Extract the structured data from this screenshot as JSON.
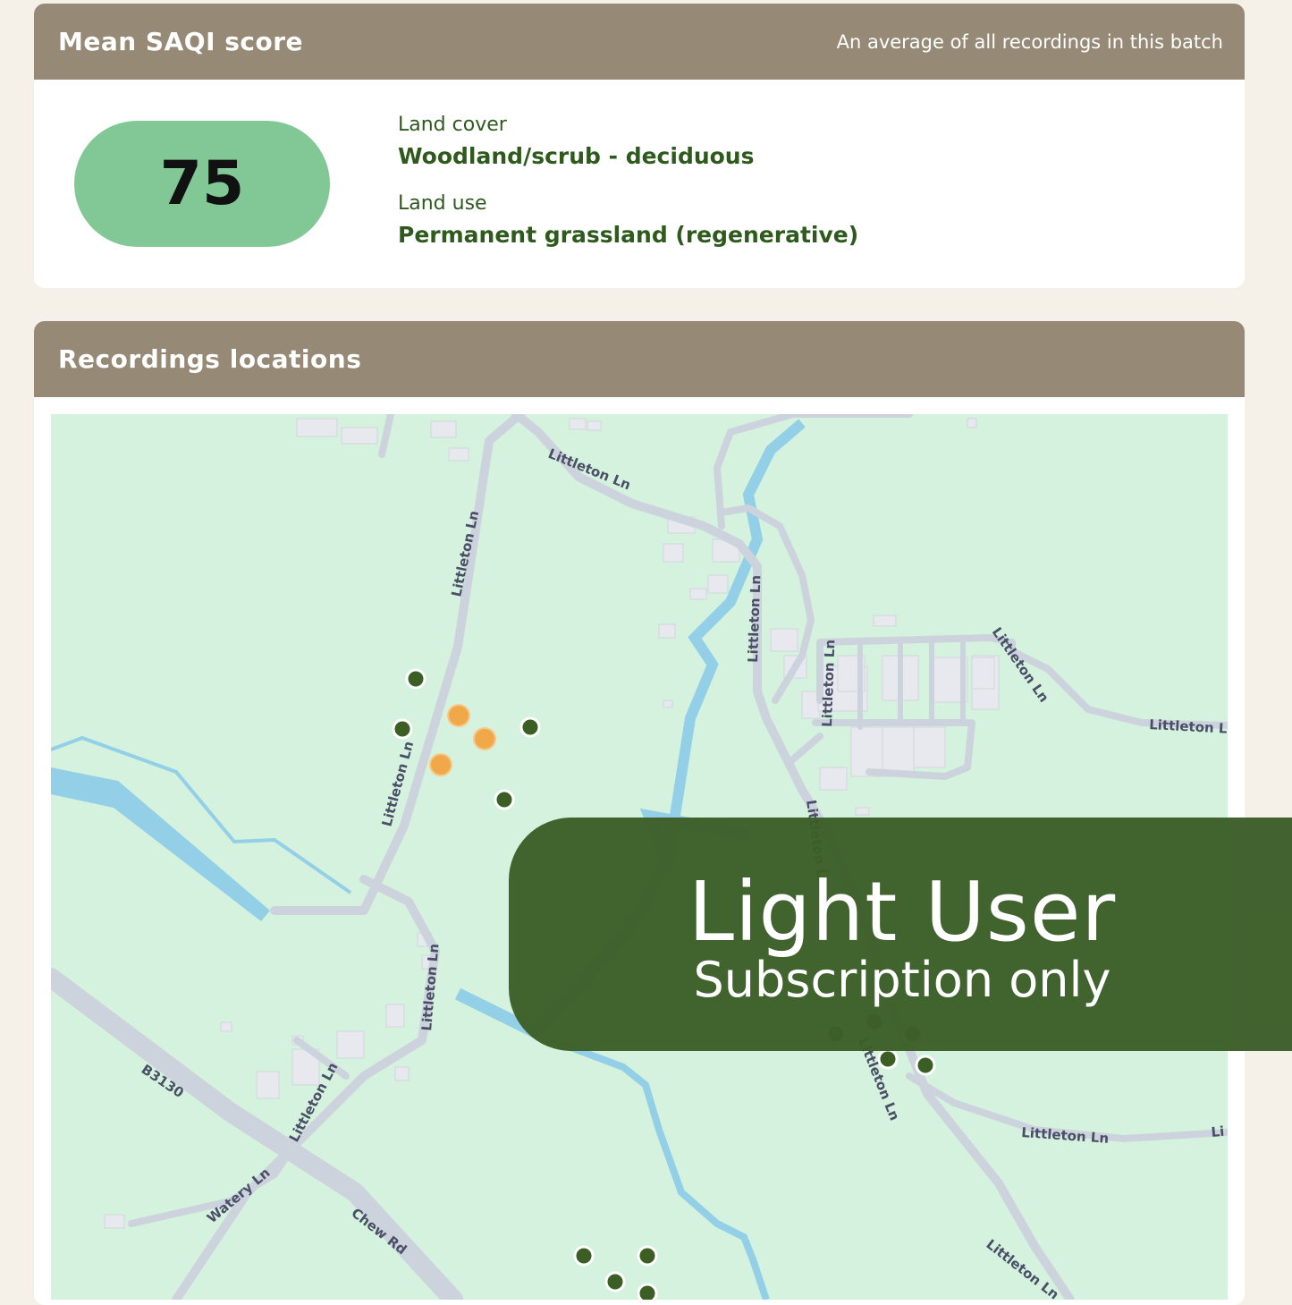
{
  "score_card": {
    "title": "Mean SAQI score",
    "subtitle": "An average of all recordings in this batch",
    "score": "75",
    "land_cover_label": "Land cover",
    "land_cover_value": "Woodland/scrub - deciduous",
    "land_use_label": "Land use",
    "land_use_value": "Permanent grassland (regenerative)"
  },
  "map_card": {
    "title": "Recordings locations",
    "road_labels": {
      "r1": "Littleton Ln",
      "r2": "Littleton Ln",
      "r3": "Littleton Ln",
      "r4": "Littleton Ln",
      "r5": "Littleton Ln",
      "r6": "Littleton Ln",
      "r7": "Littleton Ln",
      "r8": "Littleton Ln",
      "r9": "Littleton Ln",
      "r10": "Littleton Ln",
      "r11": "Littleton Ln",
      "r12": "Littleton Ln",
      "r13": "Littleton Ln",
      "r14": "B3130",
      "r15": "Chew Rd",
      "r16": "Watery Ln",
      "r17": "Li"
    },
    "colors": {
      "high_marker": "#3b5e24",
      "low_marker": "#f0a848",
      "land": "#d4f2dd",
      "water": "#93d0e8",
      "road": "#cdd3dc"
    }
  },
  "overlay": {
    "title": "Light User",
    "subtitle": "Subscription only"
  }
}
